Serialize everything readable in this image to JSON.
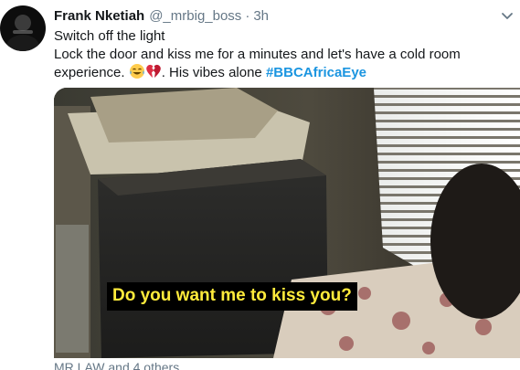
{
  "tweet": {
    "author_name": "Frank Nketiah",
    "author_handle": "@_mrbig_boss",
    "separator": "·",
    "timestamp": "3h",
    "lines": [
      "Switch off the light",
      "Lock the door and kiss me for a minutes and let's have a  cold room",
      "experience. ",
      ". His vibes alone "
    ],
    "hashtag": "#BBCAfricaEye",
    "emojis": [
      "tears-of-joy-emoji",
      "broken-heart-emoji"
    ],
    "media": {
      "caption": "Do you want me to kiss you?"
    },
    "liked_by": "MR LAW and 4 others"
  },
  "colors": {
    "text": "#14171a",
    "secondary": "#657786",
    "hashtag": "#1b95e0",
    "caption_text": "#ffeb3b",
    "caption_bg": "#000000"
  },
  "icons": [
    "avatar",
    "chevron-down-icon"
  ]
}
